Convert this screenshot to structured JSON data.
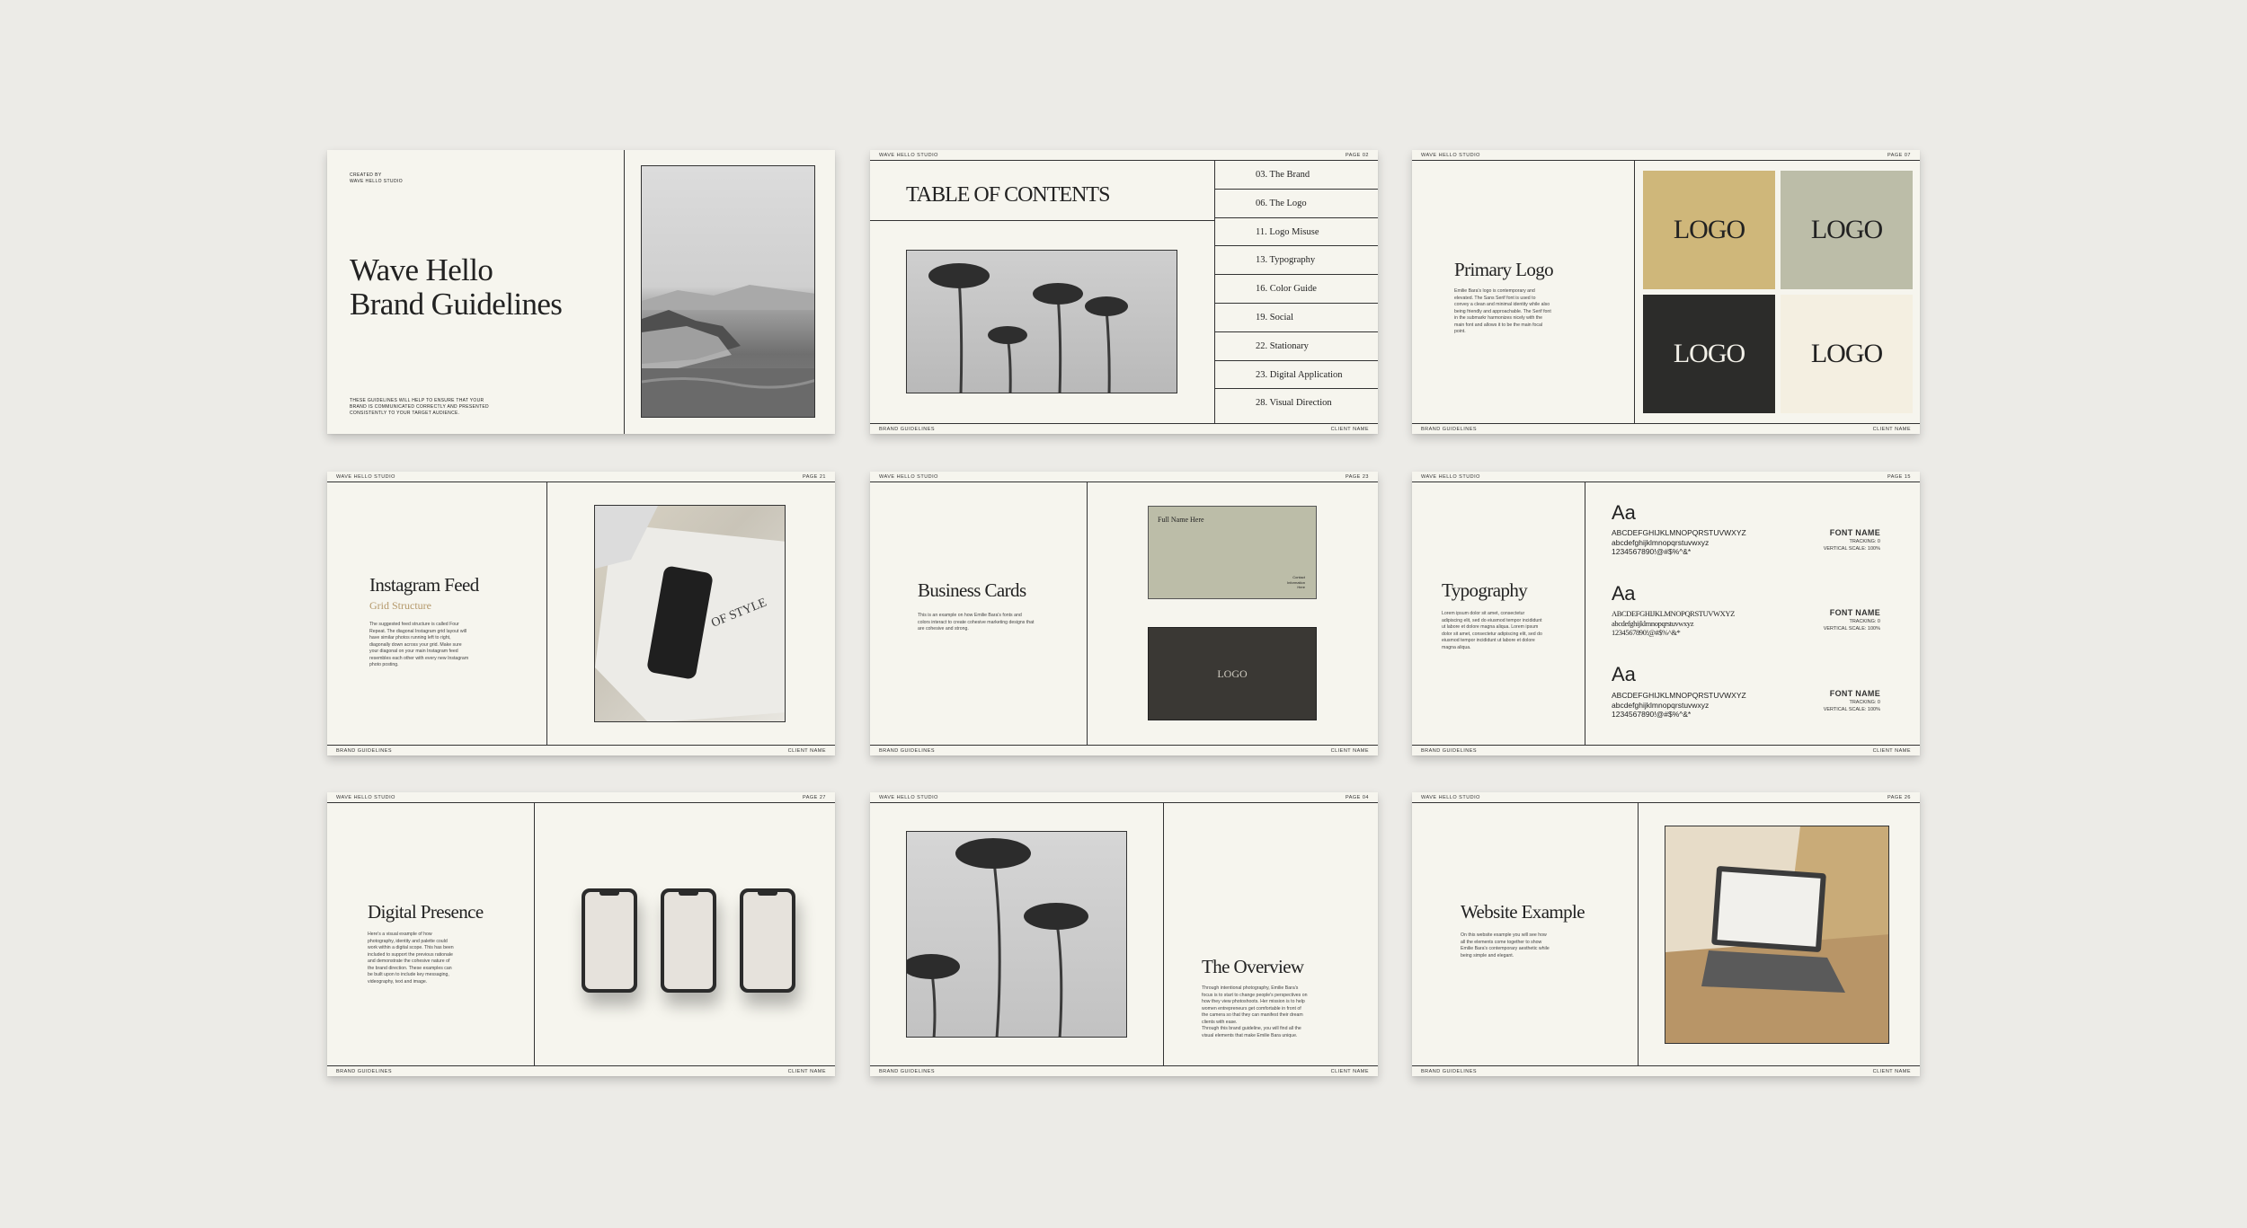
{
  "common": {
    "studio": "WAVE HELLO STUDIO",
    "footer_left": "BRAND GUIDELINES",
    "footer_right": "CLIENT NAME"
  },
  "cover": {
    "created_by": "CREATED BY\nWAVE HELLO STUDIO",
    "title_line1": "Wave Hello",
    "title_line2": "Brand Guidelines",
    "tagline": "THESE GUIDELINES WILL HELP TO ENSURE THAT YOUR BRAND IS COMMUNICATED CORRECTLY AND PRESENTED CONSISTENTLY TO YOUR TARGET AUDIENCE."
  },
  "toc": {
    "page": "PAGE 02",
    "title": "TABLE OF CONTENTS",
    "items": [
      "03. The Brand",
      "06. The Logo",
      "11. Logo Misuse",
      "13. Typography",
      "16. Color Guide",
      "19. Social",
      "22. Stationary",
      "23. Digital Application",
      "28. Visual Direction"
    ]
  },
  "primary_logo": {
    "page": "PAGE 07",
    "title": "Primary Logo",
    "body": "Emilie Bara's logo is contemporary and elevated. The Sans Serif font is used to convey a clean and minimal identity while also being friendly and approachable. The Serif font in the submarkr harmonizes nicely with the main font and allows it to be the main focal point.",
    "logo_text": "LOGO",
    "colors": [
      "#cfb77a",
      "#bcbda8",
      "#2c2c2a",
      "#f4efe1"
    ]
  },
  "instagram": {
    "page": "PAGE 21",
    "title": "Instagram Feed",
    "subtitle": "Grid Structure",
    "body": "The suggested feed structure is called Four Repeat. The diagonal Instagram grid layout will have similar photos running left to right, diagonally down across your grid. Make sure your diagonal on your main Instagram feed resembles each other with every new Instagram photo posting.",
    "book_text": "OF STYLE"
  },
  "business_cards": {
    "page": "PAGE 23",
    "title": "Business Cards",
    "body": "This is an example on how Emilie Bara's fonts and colors interact to create cohesive marketing designs that are cohesive and strong.",
    "card_name": "Full Name Here",
    "card_details": "Contact\nInformation\nHere",
    "card_logo": "LOGO"
  },
  "typography": {
    "page": "PAGE 15",
    "title": "Typography",
    "body": "Lorem ipsum dolor sit amet, consectetur adipiscing elit, sed do eiusmod tempor incididunt ut labore et dolore magna aliqua. Lorem ipsum dolor sit amet, consectetur adipiscing elit, sed do eiusmod tempor incididunt ut labore et dolore magna aliqua.",
    "fonts": [
      {
        "aa": "Aa",
        "upper": "ABCDEFGHIJKLMNOPQRSTUVWXYZ",
        "lower": "abcdefghijklmnopqrstuvwxyz",
        "nums": "1234567890!@#$%^&*",
        "name": "FONT NAME",
        "tracking": "TRACKING: 0",
        "scale": "VERTICAL SCALE: 100%"
      },
      {
        "aa": "Aa",
        "upper": "ABCDEFGHIJKLMNOPQRSTUVWXYZ",
        "lower": "abcdefghijklmnopqrstuvwxyz",
        "nums": "1234567890!@#$%^&*",
        "name": "FONT NAME",
        "tracking": "TRACKING: 0",
        "scale": "VERTICAL SCALE: 100%"
      },
      {
        "aa": "Aa",
        "upper": "ABCDEFGHIJKLMNOPQRSTUVWXYZ",
        "lower": "abcdefghijklmnopqrstuvwxyz",
        "nums": "1234567890!@#$%^&*",
        "name": "FONT NAME",
        "tracking": "TRACKING: 0",
        "scale": "VERTICAL SCALE: 100%"
      }
    ]
  },
  "digital": {
    "page": "PAGE 27",
    "title": "Digital Presence",
    "body": "Here's a visual example of how photography, identity and palette could work within a digital scope. This has been included to support the previous rationale and demonstrate the cohesive nature of the brand direction. These examples can be built upon to include key messaging, videography, text and image."
  },
  "overview": {
    "page": "PAGE 04",
    "title": "The Overview",
    "body1": "Through intentional photography, Emilie Bara's focus is to start to change people's perspectives on how they view photoshoots. Her mission is to help women entrepreneurs get comfortable in front of the camera so that they can manifest their dream clients with ease.",
    "body2": "Through this brand guideline, you will find all the visual elements that make Emilie Bara unique."
  },
  "website": {
    "page": "PAGE 26",
    "title": "Website Example",
    "body": "On this website example you will see how all the elements come together to show Emilie Bara's contemporary aesthetic while being simple and elegant."
  }
}
